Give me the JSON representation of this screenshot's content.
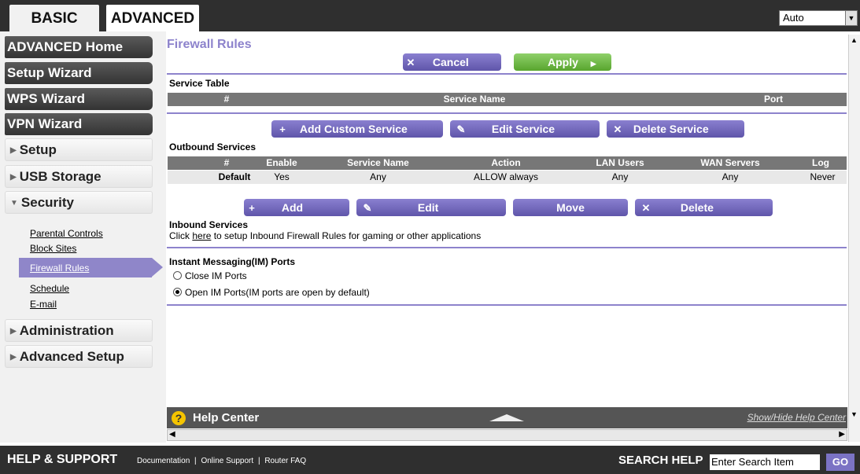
{
  "tabs": {
    "basic": "BASIC",
    "advanced": "ADVANCED"
  },
  "language_select": {
    "value": "Auto"
  },
  "sidebar": {
    "advanced_home": "ADVANCED Home",
    "setup_wizard": "Setup Wizard",
    "wps_wizard": "WPS Wizard",
    "vpn_wizard": "VPN Wizard",
    "setup": "Setup",
    "usb_storage": "USB Storage",
    "security": "Security",
    "security_items": [
      "Parental Controls",
      "Block Sites",
      "Firewall Rules",
      "Schedule",
      "E-mail"
    ],
    "administration": "Administration",
    "advanced_setup": "Advanced Setup"
  },
  "page": {
    "title": "Firewall Rules",
    "cancel": "Cancel",
    "apply": "Apply",
    "service_table": {
      "title": "Service Table",
      "headers": [
        "#",
        "Service Name",
        "Port"
      ]
    },
    "service_buttons": {
      "add": "Add Custom Service",
      "edit": "Edit Service",
      "delete": "Delete Service"
    },
    "outbound": {
      "title": "Outbound Services",
      "headers": [
        "#",
        "Enable",
        "Service Name",
        "Action",
        "LAN Users",
        "WAN Servers",
        "Log"
      ],
      "row": [
        "Default",
        "Yes",
        "Any",
        "ALLOW always",
        "Any",
        "Any",
        "Never"
      ]
    },
    "rule_buttons": {
      "add": "Add",
      "edit": "Edit",
      "move": "Move",
      "delete": "Delete"
    },
    "inbound": {
      "title": "Inbound Services",
      "text_prefix": "Click ",
      "link": "here",
      "text_suffix": " to setup Inbound Firewall Rules for gaming or other applications"
    },
    "im": {
      "title": "Instant Messaging(IM) Ports",
      "close": "Close IM Ports",
      "open": "Open IM Ports(IM ports are open by default)",
      "selected": "open"
    }
  },
  "help": {
    "title": "Help Center",
    "toggle": "Show/Hide Help Center"
  },
  "footer": {
    "title": "HELP & SUPPORT",
    "links": [
      "Documentation",
      "Online Support",
      "Router FAQ"
    ],
    "search_label": "SEARCH HELP",
    "search_value": "Enter Search Item",
    "go": "GO"
  },
  "colors": {
    "accent": "#8d83cc",
    "apply_green": "#58a52e",
    "dark": "#2f2f2f"
  }
}
